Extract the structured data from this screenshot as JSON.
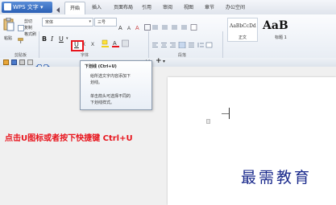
{
  "app": {
    "name": "WPS 文字"
  },
  "menubar": {
    "tabs": [
      "开始",
      "插入",
      "页面布局",
      "引用",
      "审阅",
      "视图",
      "章节",
      "办公空间"
    ]
  },
  "ribbon": {
    "clipboard": {
      "cut": "剪切",
      "copy": "复制",
      "paste": "粘贴",
      "format_painter": "格式刷",
      "group_label": "剪贴板"
    },
    "font": {
      "font_name": "宋体",
      "font_size": "三号",
      "bold": "B",
      "italic": "I",
      "underline": "U",
      "group_label": "字体"
    },
    "paragraph": {
      "group_label": "段落"
    },
    "styles": {
      "preview1": "AaBbCcDd",
      "preview1_label": "正文",
      "preview2": "AaB",
      "preview2_label": "标题 1"
    }
  },
  "doc_tab": {
    "close": "×",
    "add": "+"
  },
  "tooltip": {
    "title": "下划线 (Ctrl+U)",
    "line1": "给所选文字内容添加下",
    "line2": "划线。",
    "line3": "单击箭头可选择不同的",
    "line4": "下划线样式。"
  },
  "instruction": "点击U图标或者按下快捷键 Ctrl+U",
  "watermark": "最需教育",
  "colors": {
    "accent_red": "#e8141c",
    "watermark_blue": "#1a2a8c"
  }
}
